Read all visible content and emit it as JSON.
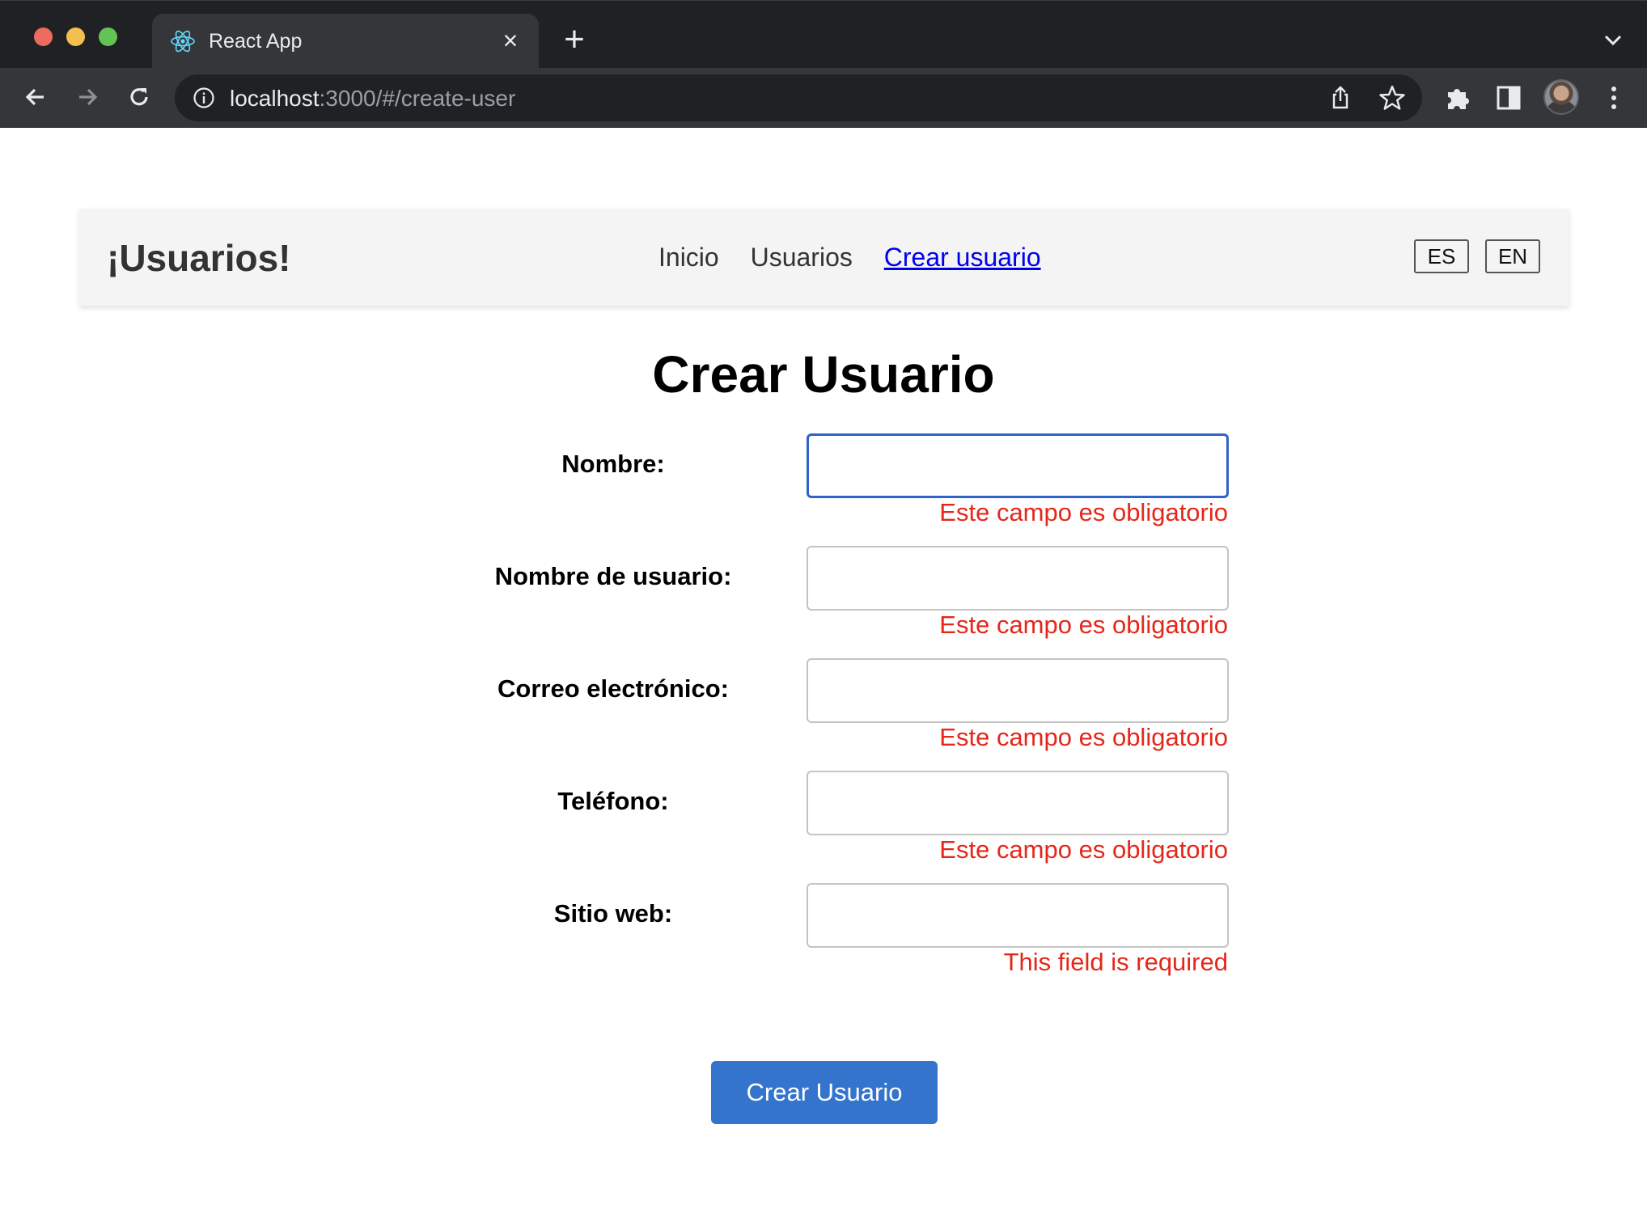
{
  "browser": {
    "tab_title": "React App",
    "url_host": "localhost",
    "url_rest": ":3000/#/create-user"
  },
  "navbar": {
    "brand": "¡Usuarios!",
    "links": [
      "Inicio",
      "Usuarios",
      "Crear usuario"
    ],
    "active_link": "Crear usuario",
    "lang_buttons": [
      "ES",
      "EN"
    ]
  },
  "form": {
    "title": "Crear Usuario",
    "fields": [
      {
        "label": "Nombre:",
        "value": "",
        "error": "Este campo es obligatorio",
        "focused": true
      },
      {
        "label": "Nombre de usuario:",
        "value": "",
        "error": "Este campo es obligatorio",
        "focused": false
      },
      {
        "label": "Correo electrónico:",
        "value": "",
        "error": "Este campo es obligatorio",
        "focused": false
      },
      {
        "label": "Teléfono:",
        "value": "",
        "error": "Este campo es obligatorio",
        "focused": false
      },
      {
        "label": "Sitio web:",
        "value": "",
        "error": "This field is required",
        "focused": false
      }
    ],
    "submit_label": "Crear Usuario"
  },
  "colors": {
    "error": "#e5271a",
    "primary_button": "#3474cc",
    "focus_border": "#2f63c7",
    "active_link": "#0000ee"
  }
}
